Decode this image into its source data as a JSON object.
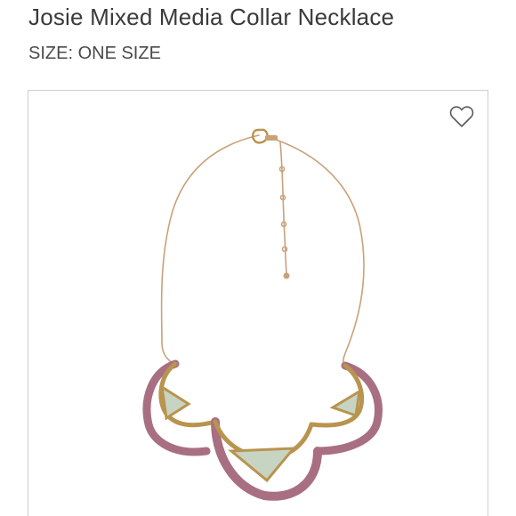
{
  "product": {
    "title": "Josie Mixed Media Collar Necklace",
    "size_label": "SIZE: ONE SIZE"
  },
  "image": {
    "favorite_icon": "heart-outline-icon"
  },
  "colors": {
    "chain": "#c9a27a",
    "gold": "#b8944f",
    "wrap": "#a86f83",
    "stone": "#c8d4c2",
    "border": "#cfcfcf"
  }
}
